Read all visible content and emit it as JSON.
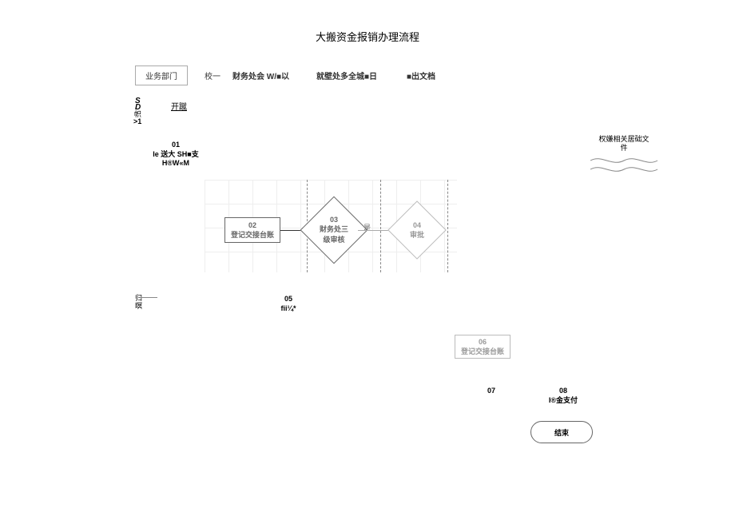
{
  "title": "大搬资金报销办理流程",
  "headers": {
    "col1": "业务部门",
    "col2a": "校一",
    "col2b": "财务处会 W/■以",
    "col3": "就壁处多全城■日",
    "col4": "■出文档"
  },
  "sidebar": {
    "line1": "S",
    "line2": "D",
    "line3": "帜",
    "line4": ">1"
  },
  "lane": {
    "a": "归",
    "b": "暝"
  },
  "start": "开蹴",
  "node01": {
    "num": "01",
    "l1": "Ie 送大 SH■支",
    "l2": "H®W«M"
  },
  "node02": {
    "num": "02",
    "label": "登记交接台账"
  },
  "node03": {
    "num": "03",
    "label": "财务处三",
    "label2": "级审核"
  },
  "edge03": "是",
  "node04": {
    "num": "04",
    "label": "审批"
  },
  "node05": {
    "num": "05",
    "label": "fii¼*"
  },
  "node06": {
    "num": "06",
    "label": "登记交接台账"
  },
  "node07": {
    "num": "07"
  },
  "node08": {
    "num": "08",
    "label": "I®金支付"
  },
  "end": "结束",
  "doc": {
    "l1": "权嫌相关居础文",
    "l2": "件"
  }
}
